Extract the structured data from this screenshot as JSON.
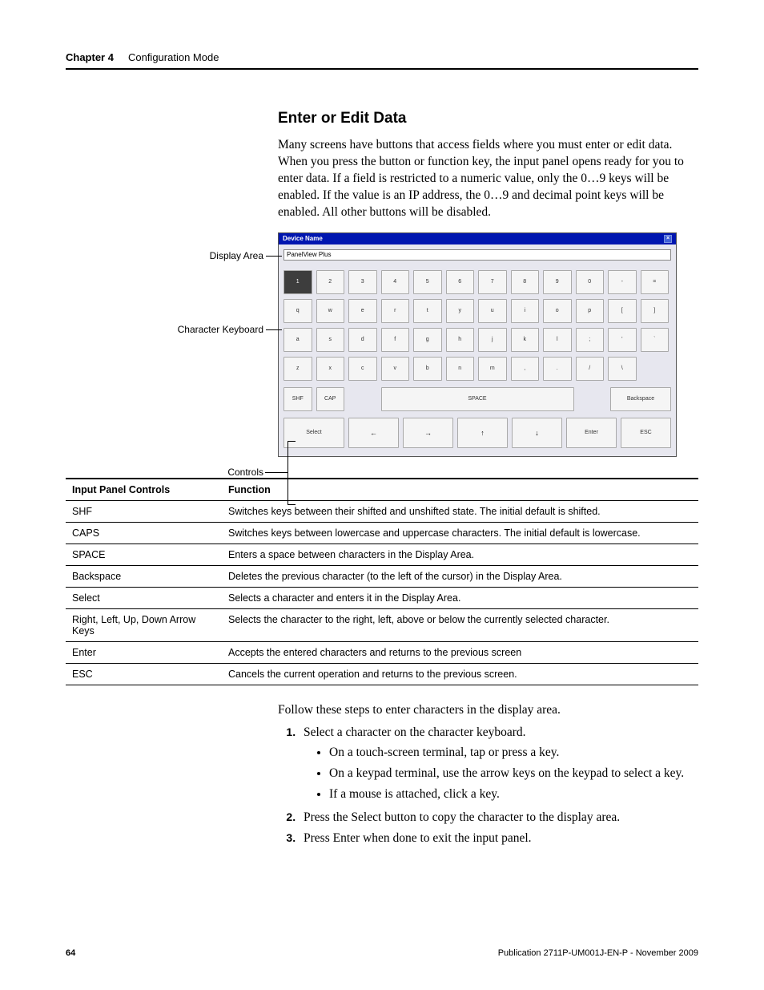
{
  "header": {
    "chapter": "Chapter 4",
    "title": "Configuration Mode"
  },
  "section_title": "Enter or Edit Data",
  "intro": "Many screens have buttons that access fields where you must enter or edit data. When you press the button or function key, the input panel opens ready for you to enter data. If a field is restricted to a numeric value, only the 0…9 keys will be enabled. If the value is an IP address, the 0…9 and decimal point keys will be enabled. All other buttons will be disabled.",
  "callouts": {
    "display_area": "Display Area",
    "character_keyboard": "Character Keyboard",
    "controls": "Controls"
  },
  "input_panel": {
    "title": "Device Name",
    "display_value": "PanelView Plus",
    "rows": [
      [
        "1",
        "2",
        "3",
        "4",
        "5",
        "6",
        "7",
        "8",
        "9",
        "0",
        "-",
        "="
      ],
      [
        "q",
        "w",
        "e",
        "r",
        "t",
        "y",
        "u",
        "i",
        "o",
        "p",
        "[",
        "]"
      ],
      [
        "a",
        "s",
        "d",
        "f",
        "g",
        "h",
        "j",
        "k",
        "l",
        ";",
        "'",
        "`"
      ],
      [
        "z",
        "x",
        "c",
        "v",
        "b",
        "n",
        "m",
        ",",
        ".",
        "/",
        "\\"
      ]
    ],
    "controls": {
      "shf": "SHF",
      "cap": "CAP",
      "space": "SPACE",
      "backspace": "Backspace"
    },
    "nav": {
      "select": "Select",
      "enter": "Enter",
      "esc": "ESC"
    }
  },
  "table": {
    "headers": {
      "c1": "Input Panel Controls",
      "c2": "Function"
    },
    "rows": [
      {
        "c1": "SHF",
        "c2": "Switches keys between their shifted and unshifted state. The initial default is shifted."
      },
      {
        "c1": "CAPS",
        "c2": "Switches keys between lowercase and uppercase characters. The initial default is lowercase."
      },
      {
        "c1": "SPACE",
        "c2": "Enters a space between characters in the Display Area."
      },
      {
        "c1": "Backspace",
        "c2": "Deletes the previous character (to the left of the cursor) in the Display Area."
      },
      {
        "c1": "Select",
        "c2": "Selects a character and enters it in the Display Area."
      },
      {
        "c1": "Right, Left, Up, Down Arrow Keys",
        "c2": "Selects the character to the right, left, above or below the currently selected character."
      },
      {
        "c1": "Enter",
        "c2": "Accepts the entered characters and returns to the previous screen"
      },
      {
        "c1": "ESC",
        "c2": "Cancels the current operation and returns to the previous screen."
      }
    ]
  },
  "follow_text": "Follow these steps to enter characters in the display area.",
  "steps": {
    "s1": "Select a character on the character keyboard.",
    "s1_sub": [
      "On a touch-screen terminal, tap or press a key.",
      "On a keypad terminal, use the arrow keys on the keypad to select a key.",
      "If a mouse is attached, click a key."
    ],
    "s2": "Press the Select button to copy the character to the display area.",
    "s3": "Press Enter when done to exit the input panel."
  },
  "footer": {
    "page": "64",
    "pub": "Publication 2711P-UM001J-EN-P - November 2009"
  }
}
